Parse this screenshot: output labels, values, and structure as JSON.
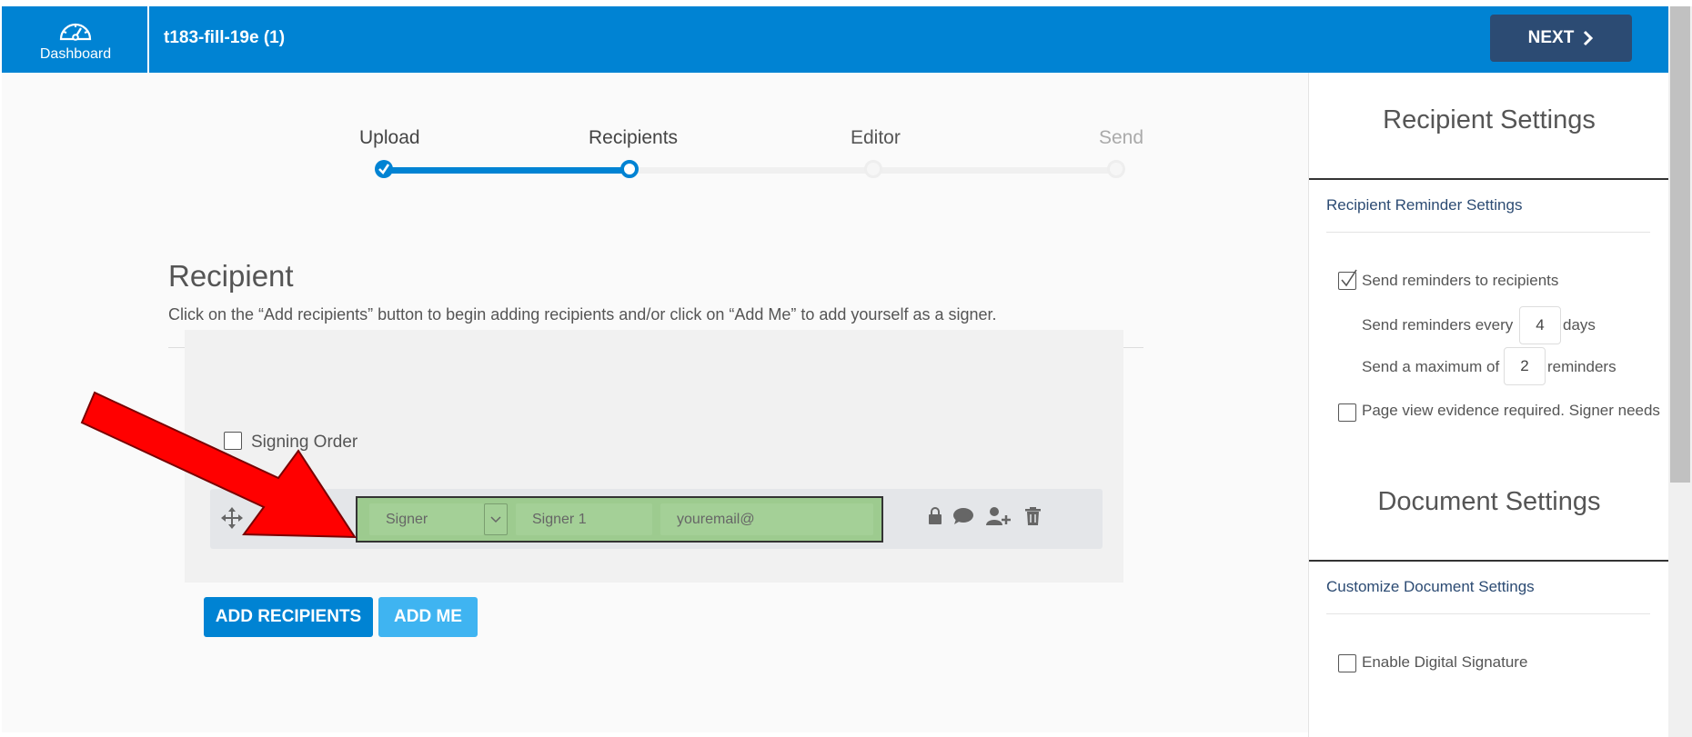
{
  "header": {
    "dashboard_label": "Dashboard",
    "document_title": "t183-fill-19e (1)",
    "next_label": "NEXT"
  },
  "stepper": {
    "steps": [
      {
        "label": "Upload",
        "state": "done"
      },
      {
        "label": "Recipients",
        "state": "current"
      },
      {
        "label": "Editor",
        "state": "pending"
      },
      {
        "label": "Send",
        "state": "pending"
      }
    ]
  },
  "recipient": {
    "heading": "Recipient",
    "description": "Click on the “Add recipients” button to begin adding recipients and/or click on “Add Me” to add yourself as a signer.",
    "signing_order_label": "Signing Order",
    "row": {
      "role_value": "Signer",
      "name_placeholder": "Signer 1",
      "email_placeholder": "youremail@"
    },
    "add_recipients_label": "ADD RECIPIENTS",
    "add_me_label": "ADD ME"
  },
  "settings": {
    "recipient_title": "Recipient Settings",
    "reminder_section": "Recipient Reminder Settings",
    "send_reminders_label": "Send reminders to recipients",
    "send_reminders_checked": true,
    "every_prefix": "Send reminders every",
    "every_value": "4",
    "every_suffix": "days",
    "max_prefix": "Send a maximum of",
    "max_value": "2",
    "max_suffix": "reminders",
    "page_view_label": "Page view evidence required. Signer needs",
    "document_title": "Document Settings",
    "document_section": "Customize Document Settings",
    "digital_signature_label": "Enable Digital Signature"
  },
  "colors": {
    "brand_blue": "#0083d3",
    "navy": "#2c4b73",
    "light_blue": "#3fb4f1",
    "highlight_green": "#9dcb8f",
    "arrow_red": "#ff0000"
  }
}
